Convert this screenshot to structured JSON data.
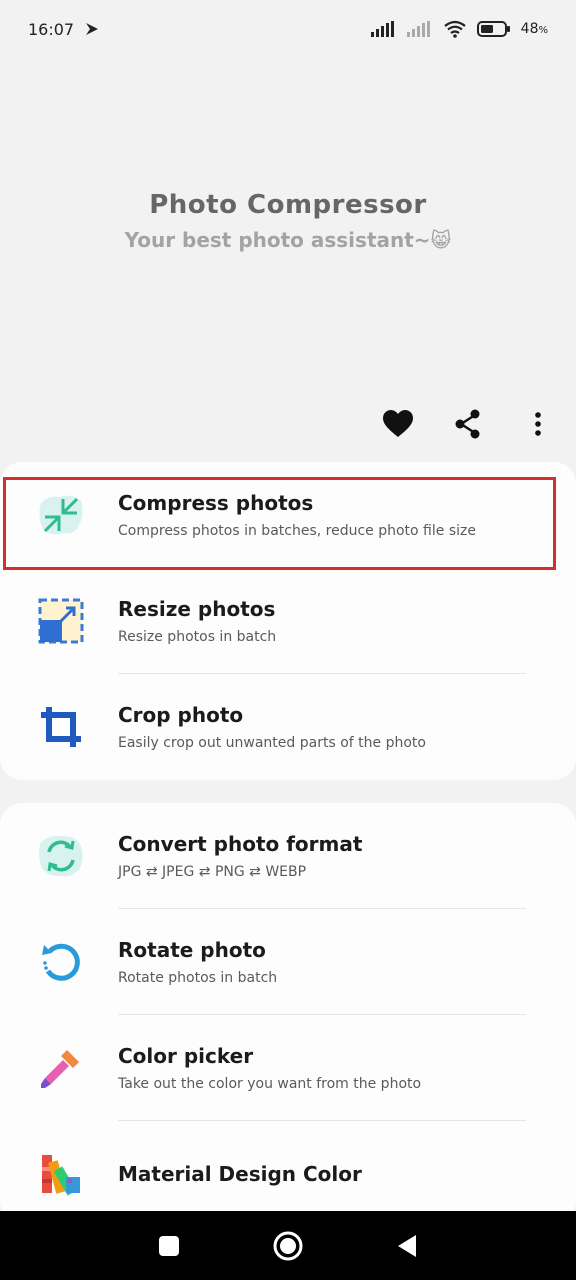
{
  "status_bar": {
    "time": "16:07",
    "battery_percent": "48",
    "battery_suffix": "%",
    "icons": [
      "notification-icon",
      "signal-icon",
      "signal-2-icon",
      "wifi-icon",
      "battery-icon"
    ]
  },
  "header": {
    "title": "Photo Compressor",
    "subtitle": "Your best photo assistant~😸"
  },
  "actions": {
    "icons": [
      "heart-icon",
      "share-icon",
      "more-vert-icon"
    ]
  },
  "group1": [
    {
      "title": "Compress photos",
      "desc": "Compress photos in batches, reduce photo file size",
      "icon": "compress-icon"
    },
    {
      "title": "Resize photos",
      "desc": "Resize photos in batch",
      "icon": "resize-icon"
    },
    {
      "title": "Crop photo",
      "desc": "Easily crop out unwanted parts of the photo",
      "icon": "crop-icon"
    }
  ],
  "group2": [
    {
      "title": "Convert photo format",
      "desc": "JPG ⇄ JPEG ⇄ PNG ⇄ WEBP",
      "icon": "convert-icon"
    },
    {
      "title": "Rotate photo",
      "desc": "Rotate photos in batch",
      "icon": "rotate-icon"
    },
    {
      "title": "Color picker",
      "desc": "Take out the color you want from the photo",
      "icon": "eyedropper-icon"
    },
    {
      "title": "Material Design Color",
      "desc": "",
      "icon": "palette-icon"
    }
  ],
  "nav": {
    "icons": [
      "recents-icon",
      "home-icon",
      "back-icon"
    ]
  },
  "colors": {
    "highlight": "#d32f2f",
    "title": "#666666",
    "subtitle": "#a3a3a3",
    "card": "#fdfdfd",
    "background": "#f2f2f2"
  }
}
